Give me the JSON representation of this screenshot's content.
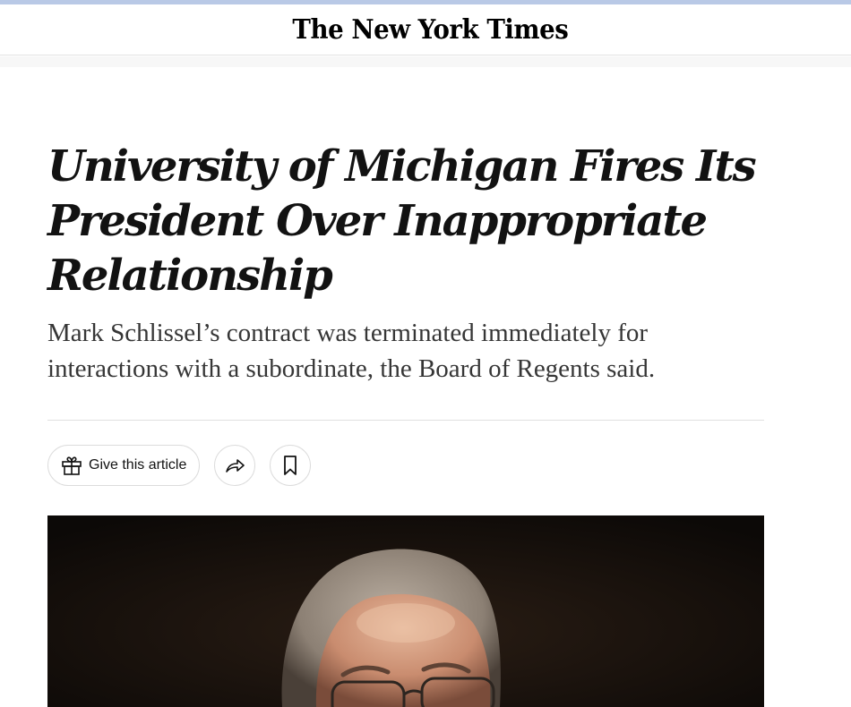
{
  "masthead": {
    "logo_text": "The New York Times"
  },
  "article": {
    "headline": "University of Michigan Fires Its President Over Inappropriate Relationship",
    "summary": "Mark Schlissel’s contract was terminated immediately for interactions with a subordinate, the Board of Regents said."
  },
  "share_tools": {
    "gift_label": "Give this article",
    "gift_icon": "gift-icon",
    "share_icon": "share-icon",
    "save_icon": "bookmark-icon"
  },
  "colors": {
    "top_strip": "#b9c9e6",
    "headline": "#121212",
    "summary": "#363636",
    "photo_background": "#120e0b"
  }
}
